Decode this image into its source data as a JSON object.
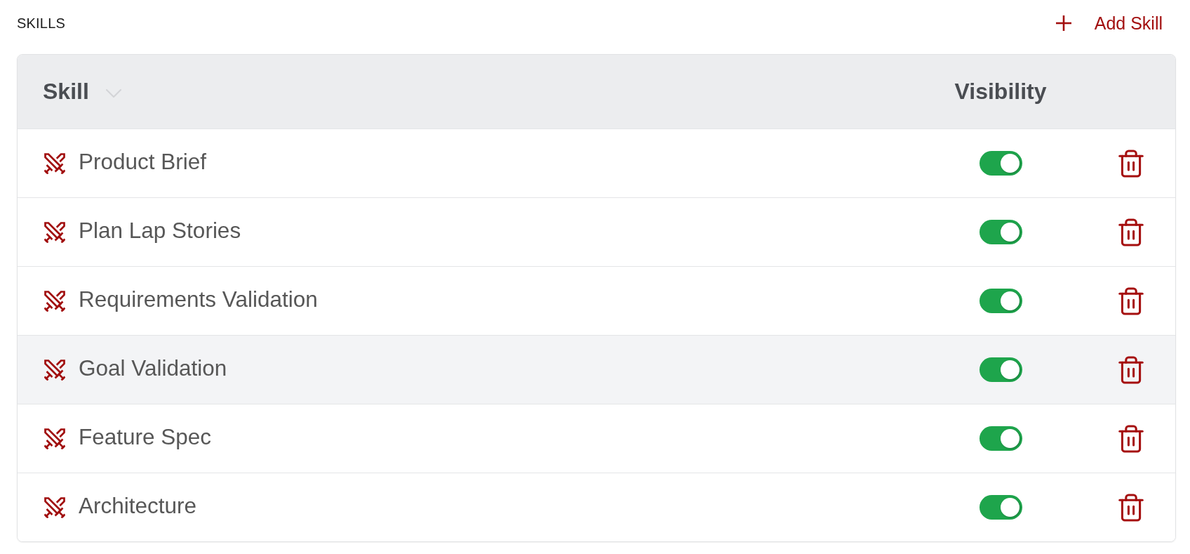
{
  "header": {
    "title": "SKILLS",
    "add_button": {
      "label": "Add Skill"
    }
  },
  "table": {
    "columns": [
      {
        "label": "Skill",
        "sortable": true
      },
      {
        "label": "Visibility",
        "sortable": false
      }
    ],
    "rows": [
      {
        "name": "Product Brief",
        "visible": true,
        "highlighted": false
      },
      {
        "name": "Plan Lap Stories",
        "visible": true,
        "highlighted": false
      },
      {
        "name": "Requirements Validation",
        "visible": true,
        "highlighted": false
      },
      {
        "name": "Goal Validation",
        "visible": true,
        "highlighted": true
      },
      {
        "name": "Feature Spec",
        "visible": true,
        "highlighted": false
      },
      {
        "name": "Architecture",
        "visible": true,
        "highlighted": false
      }
    ]
  }
}
